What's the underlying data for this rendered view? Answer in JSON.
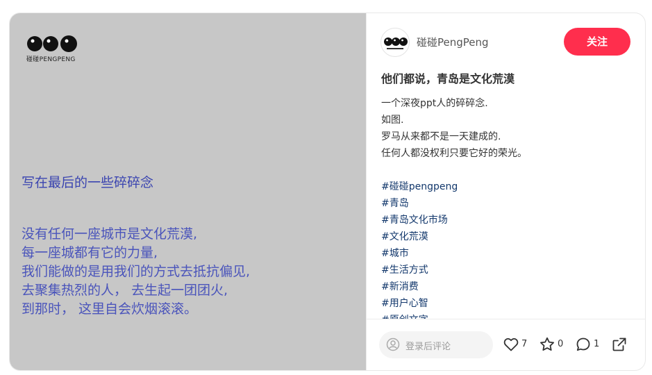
{
  "image": {
    "logo_text": "碰碰PENGPENG",
    "heading": "写在最后的一些碎碎念",
    "body_lines": [
      "没有任何一座城市是文化荒漠,",
      "每一座城都有它的力量,",
      "我们能做的是用我们的方式去抵抗偏见,",
      "去聚集热烈的人， 去生起一团团火,",
      "到那时， 这里自会炊烟滚滚。"
    ]
  },
  "author": {
    "name": "碰碰PengPeng",
    "follow_label": "关注"
  },
  "note": {
    "title": "他们都说，青岛是文化荒漠",
    "desc_lines": [
      "一个深夜ppt人的碎碎念.",
      "如图.",
      "罗马从来都不是一天建成的.",
      "任何人都没权利只要它好的荣光。"
    ],
    "tags": [
      "#碰碰pengpeng",
      "#青岛",
      "#青岛文化市场",
      "#文化荒漠",
      "#城市",
      "#生活方式",
      "#新消费",
      "#用户心智",
      "#原创文字"
    ]
  },
  "engage": {
    "comment_placeholder": "登录后评论",
    "likes": "7",
    "collects": "0",
    "comments": "1"
  },
  "colors": {
    "accent": "#ff2e4d",
    "tag": "#13386c",
    "image_bg": "#c7c7c7",
    "image_text": "#4a54bb"
  },
  "icons": [
    "logo-icon",
    "avatar-logo-icon",
    "user-icon",
    "heart-icon",
    "star-icon",
    "chat-bubble-icon",
    "share-icon"
  ]
}
